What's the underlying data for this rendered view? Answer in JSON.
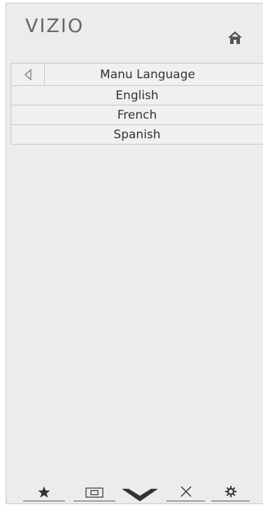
{
  "brand": {
    "logo_text": "VIZIO"
  },
  "header": {
    "home_icon": "home-icon"
  },
  "menu": {
    "title": "Manu Language",
    "back_icon": "back-triangle-icon",
    "options": [
      {
        "label": "English"
      },
      {
        "label": "French"
      },
      {
        "label": "Spanish"
      }
    ]
  },
  "bottom_nav": {
    "items": [
      {
        "icon": "star-icon"
      },
      {
        "icon": "input-icon"
      },
      {
        "icon": "vizio-v-icon"
      },
      {
        "icon": "close-icon"
      },
      {
        "icon": "gear-icon"
      }
    ]
  },
  "colors": {
    "panel_bg": "#ececec",
    "text": "#333333",
    "logo": "#666666",
    "border": "#c6c6c6"
  }
}
